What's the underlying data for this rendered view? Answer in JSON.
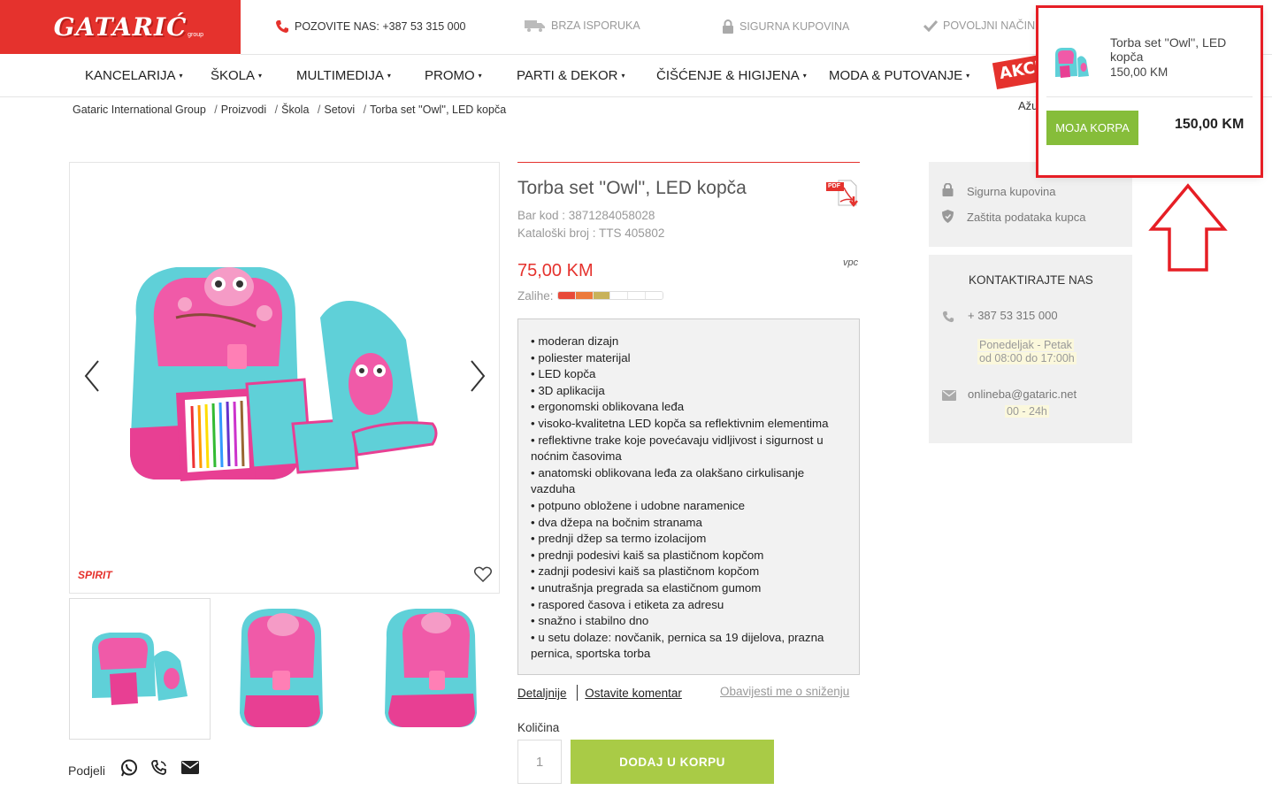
{
  "header": {
    "logo_text": "GATARIĆ",
    "logo_sub": "group",
    "phone": "POZOVITE NAS: +387 53 315 000",
    "delivery": "BRZA ISPORUKA",
    "secure": "SIGURNA KUPOVINA",
    "payment": "POVOLJNI NAČINI",
    "brand_color": "#e5322d"
  },
  "nav": {
    "items": [
      "KANCELARIJA",
      "ŠKOLA",
      "MULTIMEDIJA",
      "PROMO",
      "PARTI & DEKOR",
      "ČIŠĆENJE & HIGIJENA",
      "MODA & PUTOVANJE"
    ],
    "caret": "▾",
    "akcija": "AKCI"
  },
  "breadcrumb": [
    "Gataric International Group",
    "Proizvodi",
    "Škola",
    "Setovi",
    "Torba set ''Owl'', LED kopča"
  ],
  "breadcrumb_sep": "/",
  "azu_text": "Ažu",
  "gallery": {
    "brand": "SPIRIT",
    "prev_icon": "chevron-left-icon",
    "next_icon": "chevron-right-icon",
    "wish_icon": "heart-icon"
  },
  "product": {
    "title": "Torba set ''Owl'', LED kopča",
    "barcode": "Bar kod : 3871284058028",
    "catalog": "Kataloški broj : TTS 405802",
    "price": "75,00 KM",
    "vpc": "vpc",
    "stock_label": "Zalihe:",
    "stock_level": 0.5,
    "pdf_label": "PDF",
    "features": [
      "• moderan dizajn",
      "• poliester materijal",
      "• LED kopča",
      "• 3D aplikacija",
      "• ergonomski oblikovana leđa",
      "• visoko-kvalitetna LED kopča sa reflektivnim elementima",
      "• reflektivne trake koje povećavaju vidljivost i sigurnost u noćnim časovima",
      "• anatomski oblikovana leđa za olakšano cirkulisanje vazduha",
      "• potpuno obložene i udobne naramenice",
      "• dva džepa na bočnim stranama",
      "• prednji džep sa termo izolacijom",
      "• prednji podesivi kaiš sa plastičnom kopčom",
      "• zadnji podesivi kaiš sa plastičnom kopčom",
      "• unutrašnja pregrada sa elastičnom gumom",
      "• raspored časova i etiketa za adresu",
      "• snažno i stabilno dno",
      "• u setu dolaze: novčanik, pernica sa 19 dijelova, prazna pernica, sportska torba"
    ],
    "link_details": "Detaljnije",
    "link_comment": "Ostavite komentar",
    "link_notify": "Obavijesti me o sniženju",
    "qty_label": "Količina",
    "qty_value": "1",
    "add_button": "DODAJ U KORPU",
    "share_label": "Podjeli"
  },
  "side": {
    "secure": "Sigurna kupovina",
    "privacy": "Zaštita podataka kupca",
    "contact_title": "KONTAKTIRAJTE NAS",
    "phone": "+ 387 53 315 000",
    "hours1": "Ponedeljak - Petak",
    "hours2": "od 08:00 do 17:00h",
    "email": "onlineba@gataric.net",
    "email_hours": "00 - 24h"
  },
  "cart": {
    "item_name": "Torba set ''Owl'', LED kopča",
    "item_price": "150,00 KM",
    "button": "MOJA KORPA",
    "total": "150,00 KM",
    "highlight_color": "#e61e25"
  }
}
